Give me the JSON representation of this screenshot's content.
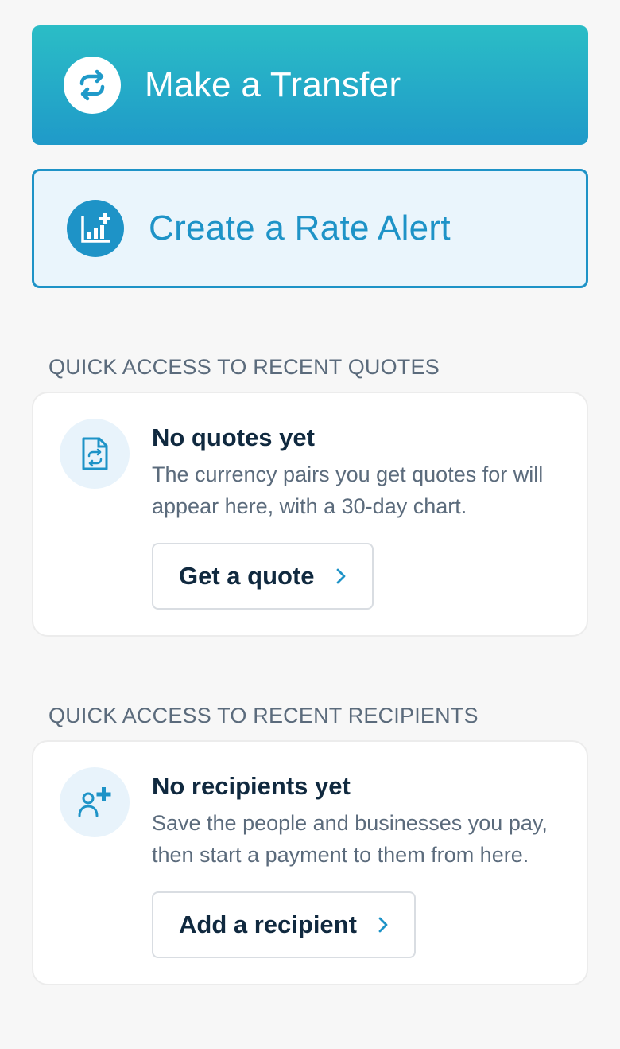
{
  "primary_actions": {
    "transfer_label": "Make a Transfer",
    "transfer_icon": "transfer-arrows-icon",
    "alert_label": "Create a Rate Alert",
    "alert_icon": "rate-alert-chart-icon"
  },
  "quotes": {
    "section_title": "QUICK ACCESS TO RECENT QUOTES",
    "icon": "quote-document-icon",
    "empty_title": "No quotes yet",
    "empty_description": "The currency pairs you get quotes for will appear here, with a 30-day chart.",
    "action_label": "Get a quote"
  },
  "recipients": {
    "section_title": "QUICK ACCESS TO RECENT RECIPIENTS",
    "icon": "add-person-icon",
    "empty_title": "No recipients yet",
    "empty_description": "Save the people and businesses you pay, then start a payment to them from here.",
    "action_label": "Add a recipient"
  },
  "colors": {
    "brand_teal": "#2bbdc6",
    "brand_blue": "#1e93c7",
    "text_dark": "#10293f",
    "text_muted": "#5b6b7c"
  }
}
